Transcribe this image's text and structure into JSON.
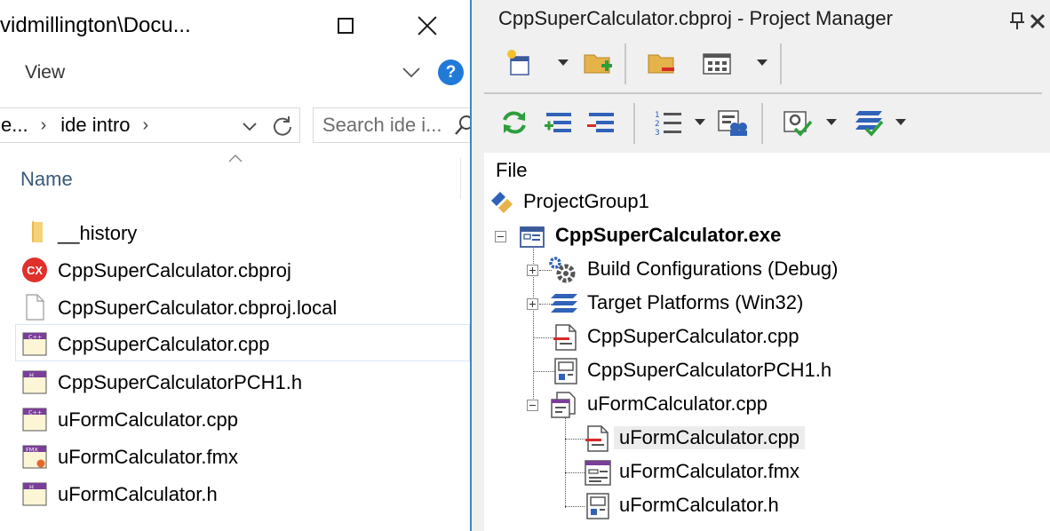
{
  "explorer": {
    "title": "vidmillington\\Docu...",
    "ribbon": {
      "view_label": "View",
      "help_label": "?"
    },
    "address": {
      "parent_segment": "e...",
      "current_folder": "ide intro"
    },
    "search": {
      "placeholder": "Search ide i..."
    },
    "column_header": "Name",
    "files": [
      {
        "name": "__history",
        "icon": "folder-icon"
      },
      {
        "name": "CppSuperCalculator.cbproj",
        "icon": "cbproj-icon",
        "badge": "CX"
      },
      {
        "name": "CppSuperCalculator.cbproj.local",
        "icon": "generic-file-icon"
      },
      {
        "name": "CppSuperCalculator.cpp",
        "icon": "cpp-file-icon",
        "badge": "C++",
        "selected": true
      },
      {
        "name": "CppSuperCalculatorPCH1.h",
        "icon": "header-file-icon",
        "badge": "H"
      },
      {
        "name": "uFormCalculator.cpp",
        "icon": "cpp-file-icon",
        "badge": "C++"
      },
      {
        "name": "uFormCalculator.fmx",
        "icon": "fmx-file-icon",
        "badge": "FMX"
      },
      {
        "name": "uFormCalculator.h",
        "icon": "header-file-icon",
        "badge": "H"
      }
    ],
    "colors": {
      "accent_border": "#3d86c6",
      "help_blue": "#1f7ad8",
      "cbproj_red": "#e0302c",
      "header_purple": "#7a3e98"
    }
  },
  "project_manager": {
    "title": "CppSuperCalculator.cbproj - Project Manager",
    "tree_header": "File",
    "tree": {
      "group": "ProjectGroup1",
      "project": "CppSuperCalculator.exe",
      "build_configurations": "Build Configurations (Debug)",
      "target_platforms": "Target Platforms (Win32)",
      "main_cpp": "CppSuperCalculator.cpp",
      "pch_header": "CppSuperCalculatorPCH1.h",
      "form_unit": "uFormCalculator.cpp",
      "form_children": [
        "uFormCalculator.cpp",
        "uFormCalculator.fmx",
        "uFormCalculator.h"
      ]
    },
    "colors": {
      "sync_green": "#2e9e3c",
      "layer_blue": "#2f62b8"
    }
  }
}
